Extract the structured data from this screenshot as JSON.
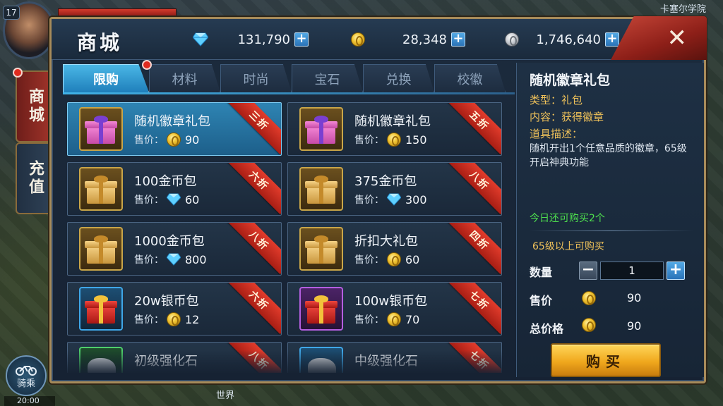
{
  "hud": {
    "level": "17",
    "location": "卡塞尔学院",
    "time": "20:00",
    "mount_label": "骑乘",
    "chat_channel": "世界"
  },
  "side_tabs": [
    {
      "label": "商城",
      "active": true
    },
    {
      "label": "充值",
      "active": false
    }
  ],
  "shop": {
    "title": "商城",
    "currencies": [
      {
        "icon": "diamond-icon",
        "value": "131,790"
      },
      {
        "icon": "gold-coin-icon",
        "value": "28,348"
      },
      {
        "icon": "silver-coin-icon",
        "value": "1,746,640"
      }
    ],
    "close_label": "✕",
    "tabs": [
      "限购",
      "材料",
      "时尚",
      "宝石",
      "兑换",
      "校徽"
    ],
    "active_tab": 0,
    "price_label": "售价：",
    "items": [
      {
        "name": "随机徽章礼包",
        "currency": "gold",
        "price": "90",
        "discount": "三折",
        "icon": "pink-gift-icon",
        "frame": "gold"
      },
      {
        "name": "随机徽章礼包",
        "currency": "gold",
        "price": "150",
        "discount": "五折",
        "icon": "pink-gift-icon",
        "frame": "gold"
      },
      {
        "name": "100金币包",
        "currency": "diamond",
        "price": "60",
        "discount": "六折",
        "icon": "gold-gift-icon",
        "frame": "gold"
      },
      {
        "name": "375金币包",
        "currency": "diamond",
        "price": "300",
        "discount": "八折",
        "icon": "gold-gift-icon",
        "frame": "gold"
      },
      {
        "name": "1000金币包",
        "currency": "diamond",
        "price": "800",
        "discount": "八折",
        "icon": "gold-gift-icon",
        "frame": "gold"
      },
      {
        "name": "折扣大礼包",
        "currency": "gold",
        "price": "60",
        "discount": "四折",
        "icon": "gold-gift-icon",
        "frame": "gold"
      },
      {
        "name": "20w银币包",
        "currency": "gold",
        "price": "12",
        "discount": "六折",
        "icon": "red-gift-icon",
        "frame": "blue"
      },
      {
        "name": "100w银币包",
        "currency": "gold",
        "price": "70",
        "discount": "七折",
        "icon": "red-gift-icon",
        "frame": "purple"
      },
      {
        "name": "初级强化石",
        "currency": "gold",
        "price": "",
        "discount": "八折",
        "icon": "stone-icon",
        "frame": "green"
      },
      {
        "name": "中级强化石",
        "currency": "gold",
        "price": "",
        "discount": "七折",
        "icon": "stone-icon",
        "frame": "blue"
      }
    ],
    "selected_item": 0
  },
  "detail": {
    "title": "随机徽章礼包",
    "type_label": "类型：",
    "type_value": "礼包",
    "content_label": "内容：",
    "content_value": "获得徽章",
    "desc_label": "道具描述：",
    "desc_text": "随机开出1个任意品质的徽章，65级开启神典功能",
    "limit_today": "今日还可购买2个",
    "level_requirement": "65级以上可购买",
    "quantity_label": "数量",
    "quantity_value": "1",
    "unit_price_label": "售价",
    "unit_price_value": "90",
    "total_price_label": "总价格",
    "total_price_value": "90",
    "buy_label": "购买"
  }
}
